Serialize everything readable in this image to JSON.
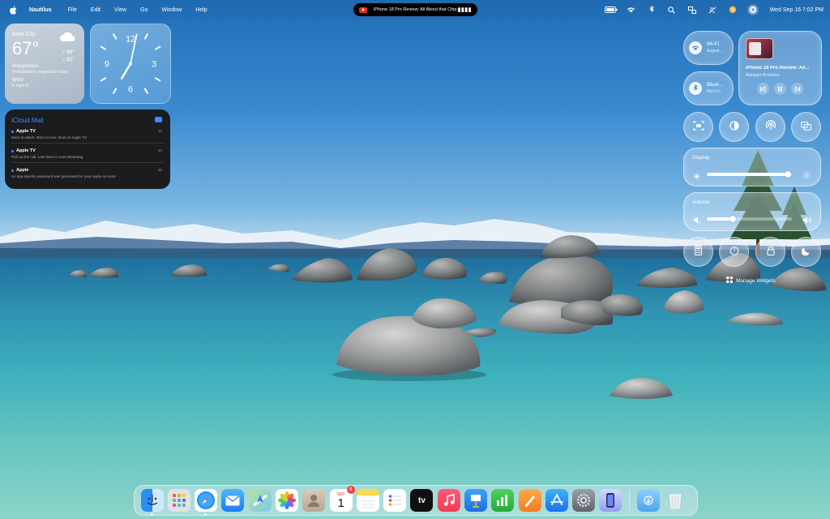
{
  "menubar": {
    "app_name": "Nautilus",
    "items": [
      "File",
      "Edit",
      "View",
      "Go",
      "Window",
      "Help"
    ],
    "clock": "Wed Sep 16  7:02 PM",
    "status_icons": [
      "battery-icon",
      "wifi-icon",
      "bluetooth-icon",
      "spotlight-icon",
      "display-icon",
      "screen-mirroring-icon",
      "focus-icon",
      "siri-icon",
      "control-center-icon"
    ]
  },
  "now_playing_pill": {
    "title": "iPhone 18 Pro Review: All About that Chip..."
  },
  "weather": {
    "city": "Iowa City",
    "temp": "67°",
    "high": "↑ 69°",
    "low": "↓ 62°",
    "precip_label": "Precipitation",
    "precip_text": "Precipitation expected today",
    "wind_label": "Wind",
    "wind_text": "6 mph E",
    "icon": "cloud-icon"
  },
  "clock_widget": {
    "numerals": [
      "12",
      "3",
      "6",
      "9"
    ],
    "hour": 7,
    "minute": 2
  },
  "mail": {
    "title": "iCloud Mail",
    "messages": [
      {
        "sender": "Apple TV",
        "preview": "More to watch. More to love. Now on Apple TV.",
        "time": "1h"
      },
      {
        "sender": "Apple TV",
        "preview": "Pick up the call. Last Seen is now streaming.",
        "time": "4h"
      },
      {
        "sender": "Apple",
        "preview": "An app-specific password was generated for your Apple Account.",
        "time": "5h"
      }
    ]
  },
  "control_center": {
    "wifi": {
      "label": "Wi-Fi",
      "sub": "August ..."
    },
    "bluetooth": {
      "label": "Bluet...",
      "sub": "Not Co..."
    },
    "media": {
      "title": "iPhone 18 Pro Review: All...",
      "artist": "Marques Brownlee"
    },
    "display": {
      "label": "Display",
      "level": 0.95
    },
    "volume": {
      "label": "Volume",
      "level": 0.3
    },
    "manage_widgets": "Manage Widgets",
    "accent": "#ffffff"
  },
  "dock": {
    "apps": [
      {
        "name": "Finder",
        "icon": "finder-icon"
      },
      {
        "name": "Launchpad",
        "icon": "launchpad-icon"
      },
      {
        "name": "Safari",
        "icon": "safari-icon"
      },
      {
        "name": "Mail",
        "icon": "mail-icon"
      },
      {
        "name": "Maps",
        "icon": "maps-icon"
      },
      {
        "name": "Photos",
        "icon": "photos-icon"
      },
      {
        "name": "Contacts",
        "icon": "contacts-icon"
      },
      {
        "name": "Calendar",
        "icon": "calendar-icon",
        "month": "SEP",
        "day": "1",
        "badge": "8"
      },
      {
        "name": "Notes",
        "icon": "notes-icon"
      },
      {
        "name": "Reminders",
        "icon": "reminders-icon"
      },
      {
        "name": "Apple TV",
        "icon": "tv-icon",
        "text": "tv"
      },
      {
        "name": "Music",
        "icon": "music-icon"
      },
      {
        "name": "Keynote",
        "icon": "keynote-icon"
      },
      {
        "name": "Numbers",
        "icon": "numbers-icon"
      },
      {
        "name": "Pages",
        "icon": "pages-icon"
      },
      {
        "name": "App Store",
        "icon": "app-store-icon"
      },
      {
        "name": "System Settings",
        "icon": "settings-icon"
      },
      {
        "name": "iPhone Mirroring",
        "icon": "iphone-mirroring-icon"
      }
    ],
    "extras": [
      {
        "name": "Downloads",
        "icon": "downloads-folder-icon"
      },
      {
        "name": "Trash",
        "icon": "trash-icon"
      }
    ]
  }
}
